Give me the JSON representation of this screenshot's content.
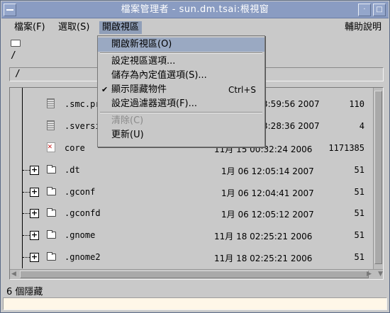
{
  "window": {
    "title": "檔案管理者 - sun.dm.tsai:根視窗"
  },
  "menubar": {
    "items": [
      {
        "label": "檔案(F)"
      },
      {
        "label": "選取(S)"
      },
      {
        "label": "開啟視區",
        "active": true
      },
      {
        "label": "輔助說明"
      }
    ]
  },
  "toolbar": {
    "path_root": "/"
  },
  "path_field": {
    "value": "/"
  },
  "dropdown": {
    "items": [
      {
        "label": "開啟新視區(O)",
        "highlighted": true
      },
      {
        "label": "設定視區選項..."
      },
      {
        "label": "儲存為內定值選項(S)..."
      },
      {
        "label": "顯示隱藏物件",
        "shortcut": "Ctrl+S",
        "checked": true
      },
      {
        "label": "設定過濾器選項(F)..."
      },
      {
        "label": "清除(C)",
        "disabled": true
      },
      {
        "label": "更新(U)"
      }
    ]
  },
  "files": {
    "rows": [
      {
        "name": ".smc.pr",
        "date": "3:59:56 2007",
        "size": "110",
        "type": "file"
      },
      {
        "name": ".sversi",
        "date": "3:28:36 2007",
        "size": "4",
        "type": "file"
      },
      {
        "name": "core",
        "date": "11月 15 00:32:24 2006",
        "size": "1171385",
        "type": "core"
      },
      {
        "name": ".dt",
        "date": "1月 06 12:05:14 2007",
        "size": "51",
        "type": "folder"
      },
      {
        "name": ".gconf",
        "date": "1月 06 12:04:41 2007",
        "size": "51",
        "type": "folder"
      },
      {
        "name": ".gconfd",
        "date": "1月 06 12:05:12 2007",
        "size": "51",
        "type": "folder"
      },
      {
        "name": ".gnome",
        "date": "11月 18 02:25:21 2006",
        "size": "51",
        "type": "folder"
      },
      {
        "name": ".gnome2",
        "date": "11月 18 02:25:21 2006",
        "size": "51",
        "type": "folder"
      }
    ]
  },
  "statusbar": {
    "text": "6 個隱藏"
  }
}
